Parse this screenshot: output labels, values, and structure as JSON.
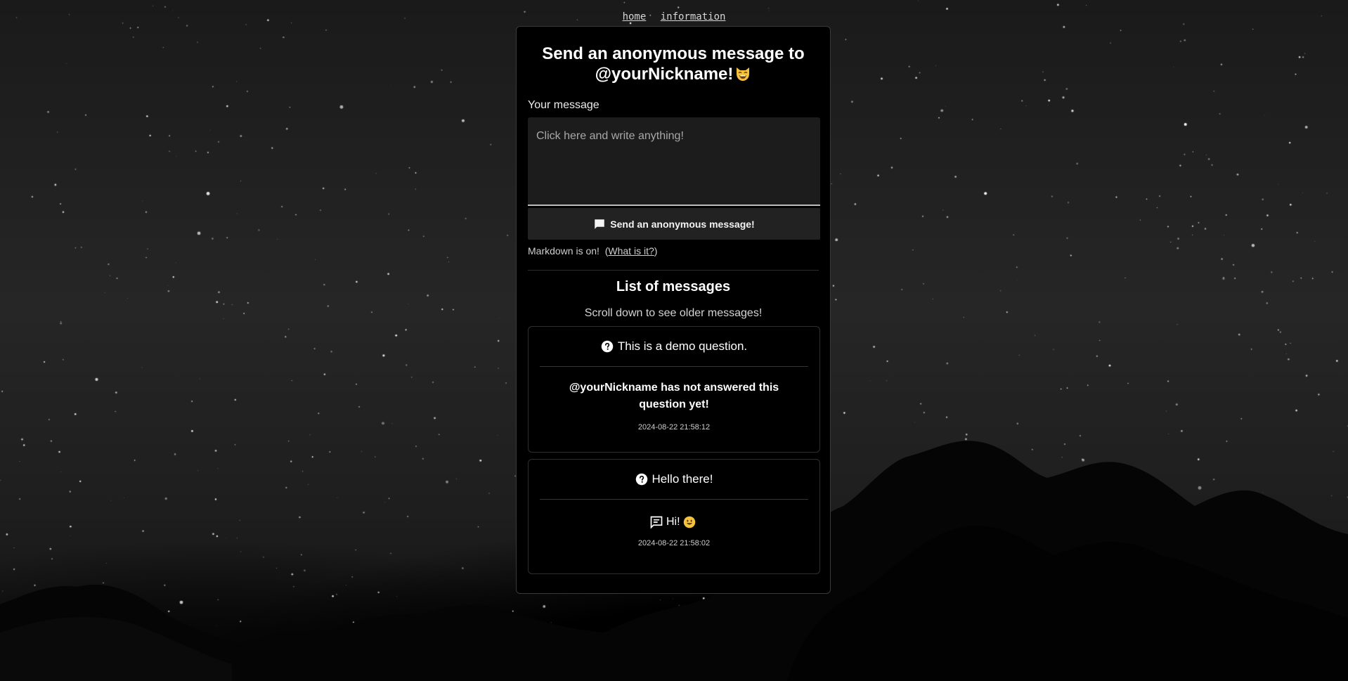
{
  "nav": {
    "home": "home",
    "information": "information"
  },
  "form": {
    "title": "Send an anonymous message to @yourNickname!",
    "title_emoji": "grinning-cat-smiling-eyes",
    "message_label": "Your message",
    "message_placeholder": "Click here and write anything!",
    "message_value": "",
    "send_label": "Send an anonymous message!",
    "send_icon": "chat-bubble-icon",
    "markdown_text": "Markdown is on!",
    "markdown_link_prefix": "(",
    "markdown_link": "What is it?",
    "markdown_link_suffix": ")"
  },
  "messages": {
    "title": "List of messages",
    "subtitle": "Scroll down to see older messages!",
    "items": [
      {
        "question": "This is a demo question.",
        "question_icon": "question-circle-icon",
        "answer": "@yourNickname has not answered this question yet!",
        "answered": false,
        "timestamp": "2024-08-22 21:58:12"
      },
      {
        "question": "Hello there!",
        "question_icon": "question-circle-icon",
        "answer": "Hi!",
        "answer_emoji": "smiling-face",
        "answer_icon": "chat-bubble-icon",
        "answered": true,
        "timestamp": "2024-08-22 21:58:02"
      }
    ]
  },
  "colors": {
    "card_bg": "#000000",
    "input_bg": "#1c1c1c",
    "button_bg": "#222222",
    "text": "#ffffff",
    "emoji_yellow": "#f5c33b"
  }
}
